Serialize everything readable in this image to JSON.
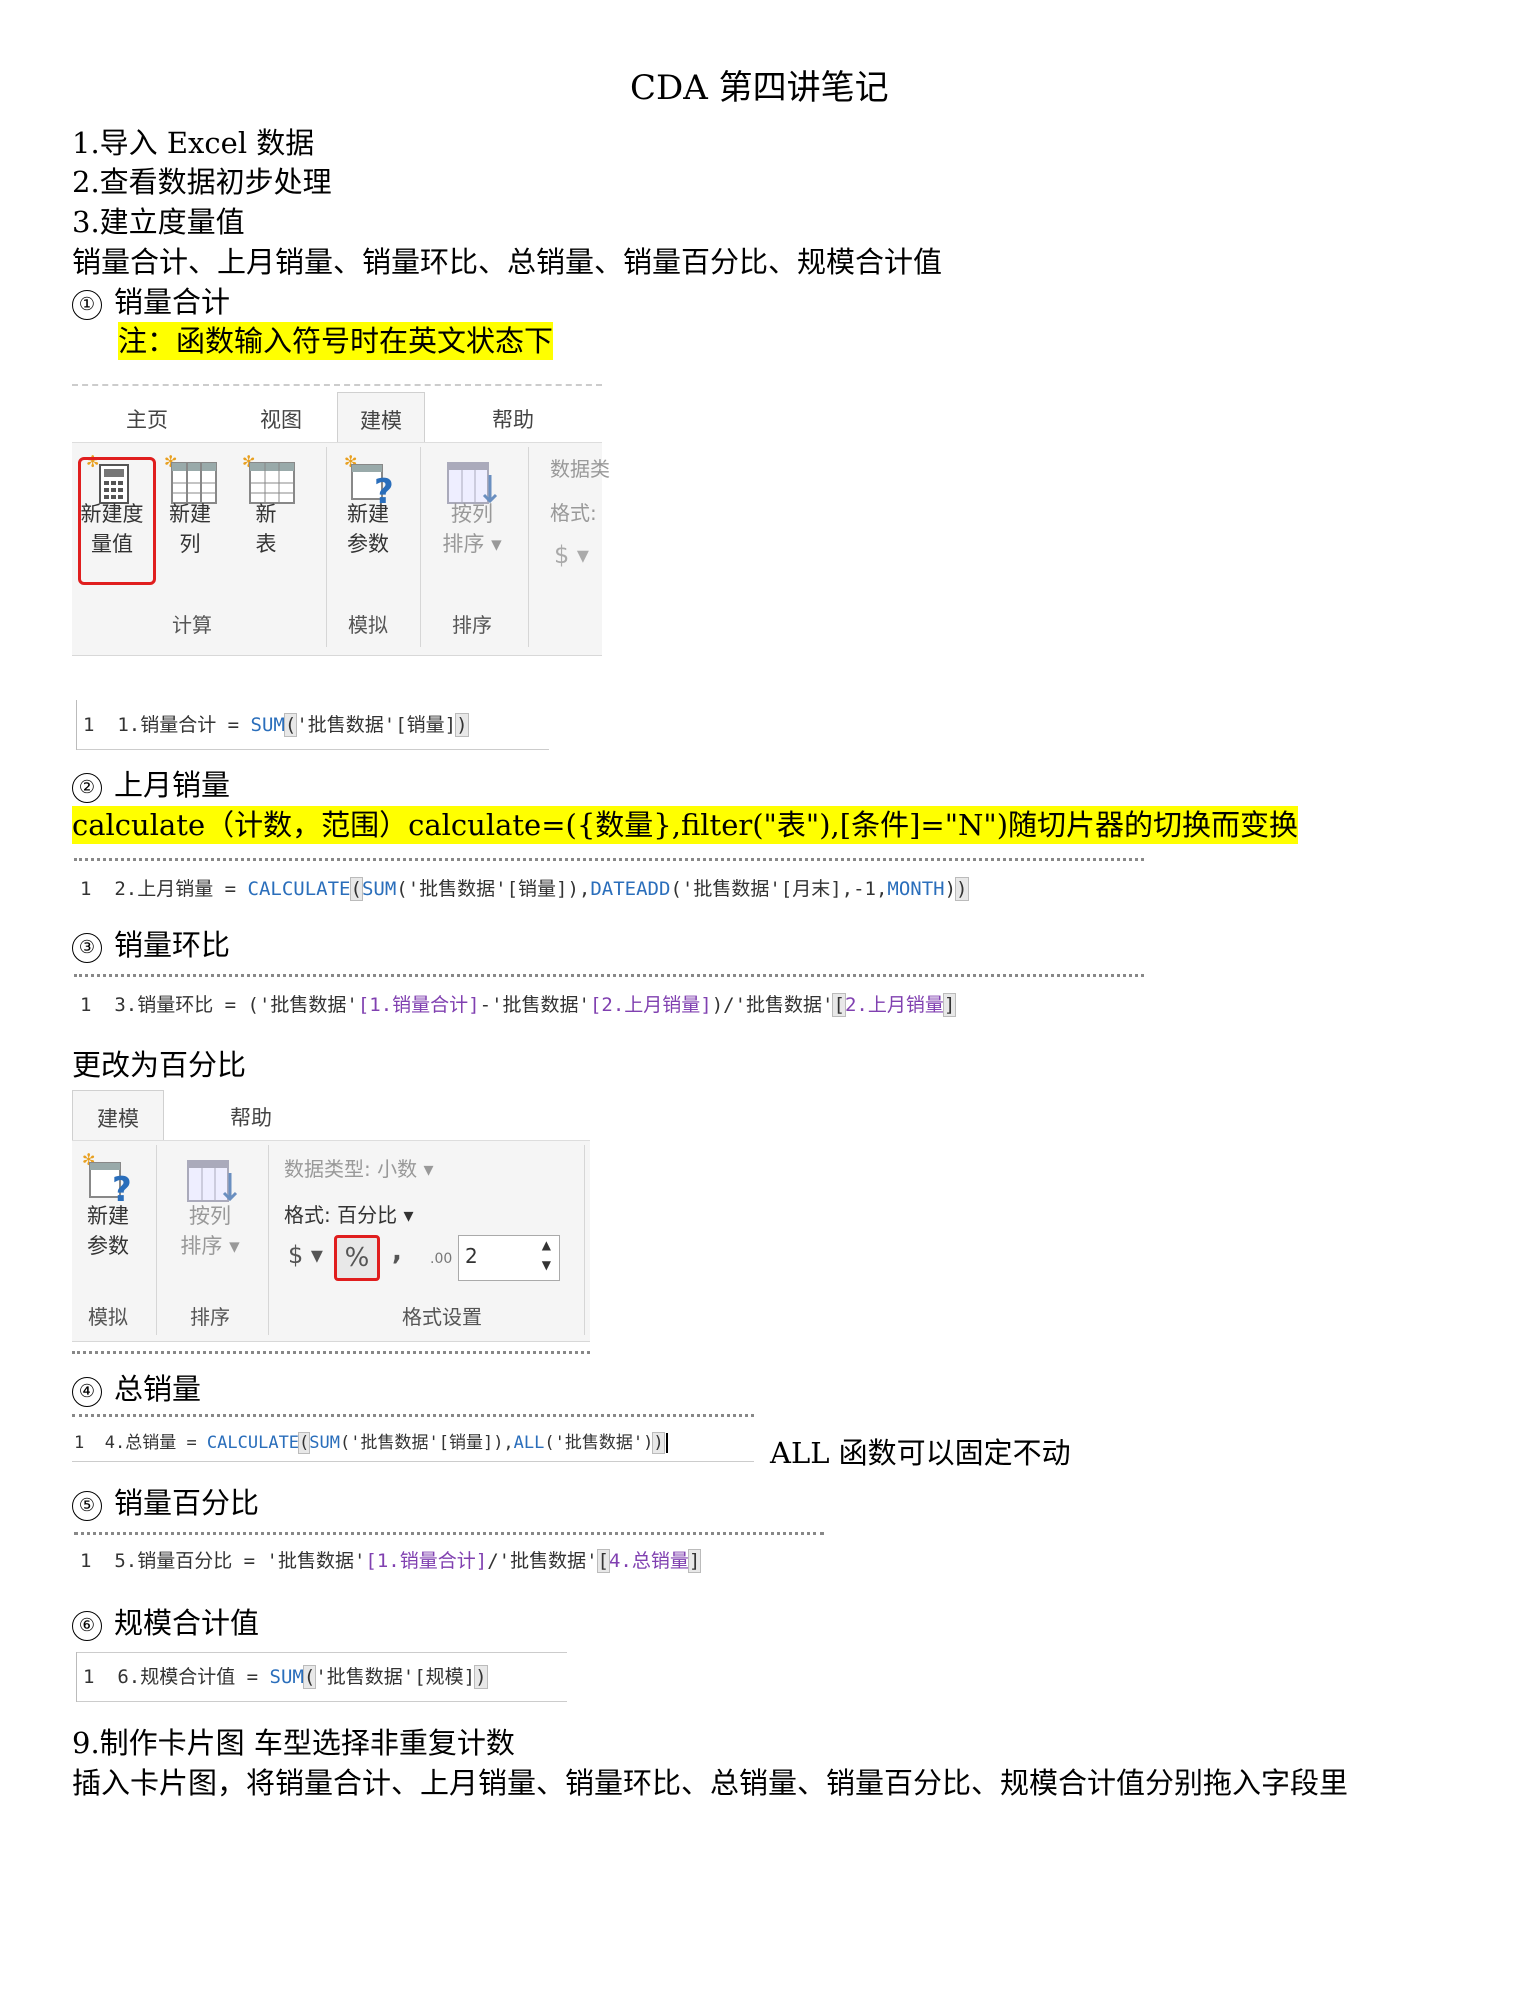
{
  "title": "CDA 第四讲笔记",
  "steps": {
    "s1": "1.导入 Excel 数据",
    "s2": "2.查看数据初步处理",
    "s3": "3.建立度量值",
    "measures_list": "销量合计、上月销量、销量环比、总销量、销量百分比、规模合计值"
  },
  "sections": {
    "m1": {
      "num": "①",
      "label": "销量合计"
    },
    "m2": {
      "num": "②",
      "label": "上月销量"
    },
    "m3": {
      "num": "③",
      "label": "销量环比"
    },
    "m4": {
      "num": "④",
      "label": "总销量"
    },
    "m5": {
      "num": "⑤",
      "label": "销量百分比"
    },
    "m6": {
      "num": "⑥",
      "label": "规模合计值"
    }
  },
  "note1": "注：函数输入符号时在英文状态下",
  "note2": "calculate（计数，范围）calculate=({数量},filter(\"表\"),[条件]=\"N\")随切片器的切换而变换",
  "change_pct": "更改为百分比",
  "all_note": "ALL 函数可以固定不动",
  "step9": "9.制作卡片图  车型选择非重复计数",
  "step9_desc": "插入卡片图，将销量合计、上月销量、销量环比、总销量、销量百分比、规模合计值分别拖入字段里",
  "ribbon1": {
    "tabs": [
      "主页",
      "视图",
      "建模",
      "帮助"
    ],
    "buttons": {
      "new_measure": [
        "新建度",
        "量值"
      ],
      "new_column": [
        "新建",
        "列"
      ],
      "new_table": [
        "新",
        "表"
      ],
      "new_param": [
        "新建",
        "参数"
      ],
      "sort_by_col": [
        "按列",
        "排序 ▾"
      ]
    },
    "groups": {
      "calc": "计算",
      "whatif": "模拟",
      "sort": "排序"
    },
    "props": {
      "datatype": "数据类",
      "format": "格式:",
      "currency": "$ ▾"
    }
  },
  "ribbon2": {
    "tabs": [
      "建模",
      "帮助"
    ],
    "buttons": {
      "new_param": [
        "新建",
        "参数"
      ],
      "sort_by_col": [
        "按列",
        "排序 ▾"
      ]
    },
    "datatype": "数据类型: 小数 ▾",
    "format": "格式: 百分比 ▾",
    "currency": "$ ▾",
    "percent": "%",
    "comma": ",",
    "decimals_icon": ".00",
    "decimals_value": "2",
    "groups": {
      "whatif": "模拟",
      "sort": "排序",
      "format": "格式设置"
    }
  },
  "code": {
    "c1": {
      "ln": "1",
      "parts": [
        "1.销量合计 = ",
        "SUM",
        "(",
        "'批售数据'[销量]",
        ")"
      ]
    },
    "c2": {
      "ln": "1",
      "parts": [
        "2.上月销量 = ",
        "CALCULATE",
        "(",
        "SUM",
        "('批售数据'[销量]),",
        "DATEADD",
        "('批售数据'[月末],-1,",
        "MONTH",
        ")",
        ")"
      ]
    },
    "c3": {
      "ln": "1",
      "parts": [
        "3.销量环比 = ('批售数据'",
        "[1.销量合计]",
        "-'批售数据'",
        "[2.上月销量]",
        ")/'批售数据'",
        "[",
        "2.上月销量",
        "]"
      ]
    },
    "c4": {
      "ln": "1",
      "parts": [
        "4.总销量 = ",
        "CALCULATE",
        "(",
        "SUM",
        "('批售数据'[销量]),",
        "ALL",
        "('批售数据')",
        ")"
      ]
    },
    "c5": {
      "ln": "1",
      "parts": [
        "5.销量百分比 = '批售数据'",
        "[1.销量合计]",
        "/'批售数据'",
        "[",
        "4.总销量",
        "]"
      ]
    },
    "c6": {
      "ln": "1",
      "parts": [
        "6.规模合计值 = ",
        "SUM",
        "(",
        "'批售数据'[规模]",
        ")"
      ]
    }
  },
  "colors": {
    "highlight": "#ffff00",
    "red_box": "#e01e1e",
    "func": "#2a6ebb",
    "column_ref": "#8040b0"
  }
}
